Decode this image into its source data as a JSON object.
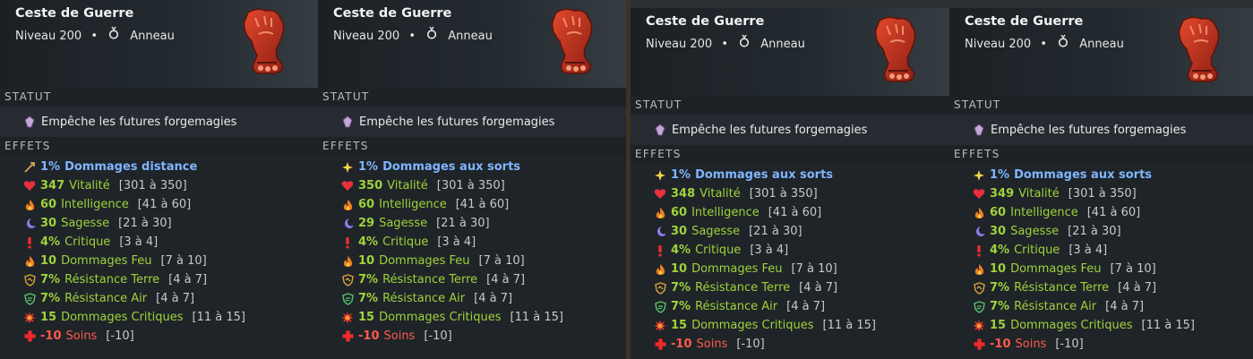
{
  "panels": [
    {
      "item": {
        "name": "Ceste de Guerre",
        "level": "Niveau 200",
        "separator": "•",
        "type": "Anneau"
      },
      "status": {
        "header": "STATUT",
        "text": "Empêche les futures forgemagies"
      },
      "effects_header": "EFFETS",
      "effects": [
        {
          "icon": "arrow-icon",
          "value": "1%",
          "name": "Dommages distance",
          "range": "",
          "color": "blue"
        },
        {
          "icon": "heart-icon",
          "value": "347",
          "name": "Vitalité",
          "range": "[301 à 350]",
          "color": "green"
        },
        {
          "icon": "fire-icon",
          "value": "60",
          "name": "Intelligence",
          "range": "[41 à 60]",
          "color": "green"
        },
        {
          "icon": "moon-icon",
          "value": "30",
          "name": "Sagesse",
          "range": "[21 à 30]",
          "color": "green"
        },
        {
          "icon": "exclamation-icon",
          "value": "4%",
          "name": "Critique",
          "range": "[3 à 4]",
          "color": "green"
        },
        {
          "icon": "fire-icon",
          "value": "10",
          "name": "Dommages Feu",
          "range": "[7 à 10]",
          "color": "green"
        },
        {
          "icon": "earth-shield-icon",
          "value": "7%",
          "name": "Résistance Terre",
          "range": "[4 à 7]",
          "color": "green"
        },
        {
          "icon": "air-shield-icon",
          "value": "7%",
          "name": "Résistance Air",
          "range": "[4 à 7]",
          "color": "green"
        },
        {
          "icon": "burst-icon",
          "value": "15",
          "name": "Dommages Critiques",
          "range": "[11 à 15]",
          "color": "green"
        },
        {
          "icon": "cross-icon",
          "value": "-10",
          "name": "Soins",
          "range": "[-10]",
          "color": "red"
        }
      ]
    },
    {
      "item": {
        "name": "Ceste de Guerre",
        "level": "Niveau 200",
        "separator": "•",
        "type": "Anneau"
      },
      "status": {
        "header": "STATUT",
        "text": "Empêche les futures forgemagies"
      },
      "effects_header": "EFFETS",
      "effects": [
        {
          "icon": "spark-icon",
          "value": "1%",
          "name": "Dommages aux sorts",
          "range": "",
          "color": "blue"
        },
        {
          "icon": "heart-icon",
          "value": "350",
          "name": "Vitalité",
          "range": "[301 à 350]",
          "color": "green"
        },
        {
          "icon": "fire-icon",
          "value": "60",
          "name": "Intelligence",
          "range": "[41 à 60]",
          "color": "green"
        },
        {
          "icon": "moon-icon",
          "value": "29",
          "name": "Sagesse",
          "range": "[21 à 30]",
          "color": "green"
        },
        {
          "icon": "exclamation-icon",
          "value": "4%",
          "name": "Critique",
          "range": "[3 à 4]",
          "color": "green"
        },
        {
          "icon": "fire-icon",
          "value": "10",
          "name": "Dommages Feu",
          "range": "[7 à 10]",
          "color": "green"
        },
        {
          "icon": "earth-shield-icon",
          "value": "7%",
          "name": "Résistance Terre",
          "range": "[4 à 7]",
          "color": "green"
        },
        {
          "icon": "air-shield-icon",
          "value": "7%",
          "name": "Résistance Air",
          "range": "[4 à 7]",
          "color": "green"
        },
        {
          "icon": "burst-icon",
          "value": "15",
          "name": "Dommages Critiques",
          "range": "[11 à 15]",
          "color": "green"
        },
        {
          "icon": "cross-icon",
          "value": "-10",
          "name": "Soins",
          "range": "[-10]",
          "color": "red"
        }
      ]
    },
    {
      "item": {
        "name": "Ceste de Guerre",
        "level": "Niveau 200",
        "separator": "•",
        "type": "Anneau"
      },
      "status": {
        "header": "STATUT",
        "text": "Empêche les futures forgemagies"
      },
      "effects_header": "EFFETS",
      "effects": [
        {
          "icon": "spark-icon",
          "value": "1%",
          "name": "Dommages aux sorts",
          "range": "",
          "color": "blue"
        },
        {
          "icon": "heart-icon",
          "value": "348",
          "name": "Vitalité",
          "range": "[301 à 350]",
          "color": "green"
        },
        {
          "icon": "fire-icon",
          "value": "60",
          "name": "Intelligence",
          "range": "[41 à 60]",
          "color": "green"
        },
        {
          "icon": "moon-icon",
          "value": "30",
          "name": "Sagesse",
          "range": "[21 à 30]",
          "color": "green"
        },
        {
          "icon": "exclamation-icon",
          "value": "4%",
          "name": "Critique",
          "range": "[3 à 4]",
          "color": "green"
        },
        {
          "icon": "fire-icon",
          "value": "10",
          "name": "Dommages Feu",
          "range": "[7 à 10]",
          "color": "green"
        },
        {
          "icon": "earth-shield-icon",
          "value": "7%",
          "name": "Résistance Terre",
          "range": "[4 à 7]",
          "color": "green"
        },
        {
          "icon": "air-shield-icon",
          "value": "7%",
          "name": "Résistance Air",
          "range": "[4 à 7]",
          "color": "green"
        },
        {
          "icon": "burst-icon",
          "value": "15",
          "name": "Dommages Critiques",
          "range": "[11 à 15]",
          "color": "green"
        },
        {
          "icon": "cross-icon",
          "value": "-10",
          "name": "Soins",
          "range": "[-10]",
          "color": "red"
        }
      ]
    },
    {
      "item": {
        "name": "Ceste de Guerre",
        "level": "Niveau 200",
        "separator": "•",
        "type": "Anneau"
      },
      "status": {
        "header": "STATUT",
        "text": "Empêche les futures forgemagies"
      },
      "effects_header": "EFFETS",
      "effects": [
        {
          "icon": "spark-icon",
          "value": "1%",
          "name": "Dommages aux sorts",
          "range": "",
          "color": "blue"
        },
        {
          "icon": "heart-icon",
          "value": "349",
          "name": "Vitalité",
          "range": "[301 à 350]",
          "color": "green"
        },
        {
          "icon": "fire-icon",
          "value": "60",
          "name": "Intelligence",
          "range": "[41 à 60]",
          "color": "green"
        },
        {
          "icon": "moon-icon",
          "value": "30",
          "name": "Sagesse",
          "range": "[21 à 30]",
          "color": "green"
        },
        {
          "icon": "exclamation-icon",
          "value": "4%",
          "name": "Critique",
          "range": "[3 à 4]",
          "color": "green"
        },
        {
          "icon": "fire-icon",
          "value": "10",
          "name": "Dommages Feu",
          "range": "[7 à 10]",
          "color": "green"
        },
        {
          "icon": "earth-shield-icon",
          "value": "7%",
          "name": "Résistance Terre",
          "range": "[4 à 7]",
          "color": "green"
        },
        {
          "icon": "air-shield-icon",
          "value": "7%",
          "name": "Résistance Air",
          "range": "[4 à 7]",
          "color": "green"
        },
        {
          "icon": "burst-icon",
          "value": "15",
          "name": "Dommages Critiques",
          "range": "[11 à 15]",
          "color": "green"
        },
        {
          "icon": "cross-icon",
          "value": "-10",
          "name": "Soins",
          "range": "[-10]",
          "color": "red"
        }
      ]
    }
  ],
  "colors": {
    "blue": "#7fb6ff",
    "green": "#9fd23a",
    "red": "#ff5a4a",
    "gauntlet": "#c8331f"
  }
}
